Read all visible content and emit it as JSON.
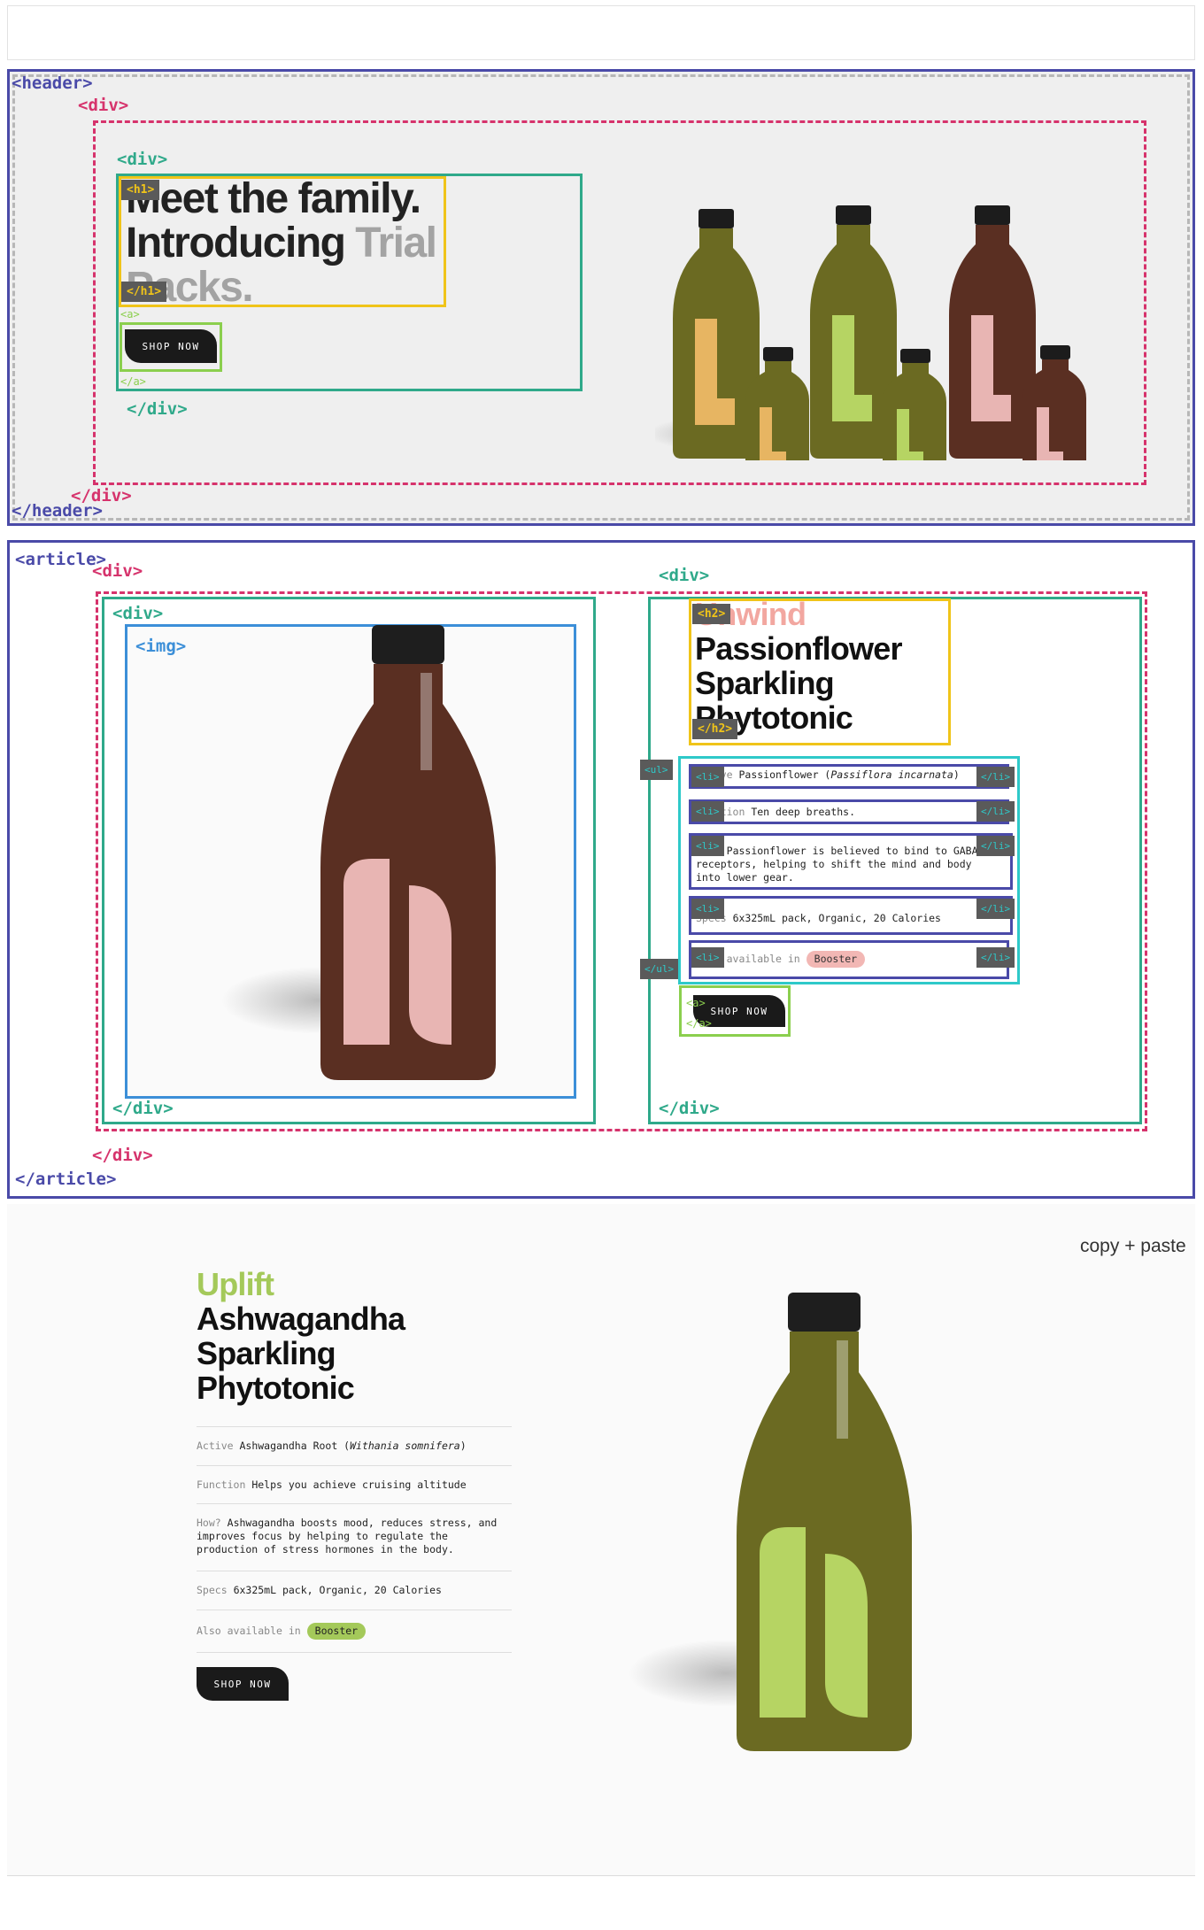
{
  "tags": {
    "header_open": "<header>",
    "header_close": "</header>",
    "div_open": "<div>",
    "div_close": "</div>",
    "h1_open": "<h1>",
    "h1_close": "</h1>",
    "a_open": "<a>",
    "a_close": "</a>",
    "article_open": "<article>",
    "article_close": "</article>",
    "img_open": "<img>",
    "h2_open": "<h2>",
    "h2_close": "</h2>",
    "ul_open": "<ul>",
    "ul_close": "</ul>",
    "li_open": "<li>",
    "li_close": "</li>"
  },
  "hero": {
    "title_line1": "Meet the family.",
    "title_line2": "Introducing ",
    "title_muted1": "Trial",
    "title_muted2": "Packs.",
    "button_label": "SHOP NOW"
  },
  "unwind": {
    "tagline": "Unwind",
    "name_line1": "Passionflower",
    "name_line2": "Sparkling",
    "name_line3": "Phytotonic",
    "specs": [
      {
        "key": "Active",
        "value": "Passionflower (",
        "italic": "Passiflora incarnata",
        "tail": ")"
      },
      {
        "key": "Function",
        "value": "Ten deep breaths."
      },
      {
        "key": "How?",
        "value": "Passionflower is believed to bind to GABA receptors, helping to shift the mind and body into lower gear."
      },
      {
        "key": "Specs",
        "value": "6x325mL pack, Organic, 20 Calories"
      },
      {
        "key": "Also available in",
        "badge": "Booster"
      }
    ],
    "button_label": "SHOP NOW",
    "accent": "#f2a7a0"
  },
  "uplift": {
    "note": "copy + paste",
    "tagline": "Uplift",
    "name_line1": "Ashwagandha",
    "name_line2": "Sparkling",
    "name_line3": "Phytotonic",
    "specs": [
      {
        "key": "Active",
        "value": "Ashwagandha Root (",
        "italic": "Withania somnifera",
        "tail": ")"
      },
      {
        "key": "Function",
        "value": "Helps you achieve cruising altitude"
      },
      {
        "key": "How?",
        "value": "Ashwagandha boosts mood, reduces stress, and improves focus by helping to regulate the production of stress hormones in the body."
      },
      {
        "key": "Specs",
        "value": "6x325mL pack, Organic, 20 Calories"
      },
      {
        "key": "Also available in",
        "badge": "Booster"
      }
    ],
    "button_label": "SHOP NOW",
    "accent": "#a4c95a"
  },
  "colors": {
    "outline_blue": "#4a4aa8",
    "outline_pink": "#d6336c",
    "outline_green": "#2fa98a",
    "outline_yellow": "#f0c419",
    "outline_lime": "#8bcf4e",
    "outline_sky": "#3c8fd8",
    "outline_cyan": "#2ec9c9",
    "bottle_amber": "#5a2f22",
    "bottle_olive": "#6b6a22",
    "label_pink": "#e8b5b3",
    "label_green": "#b6d463",
    "label_orange": "#e7b562"
  },
  "icons": {
    "bottle": "bottle-icon"
  }
}
